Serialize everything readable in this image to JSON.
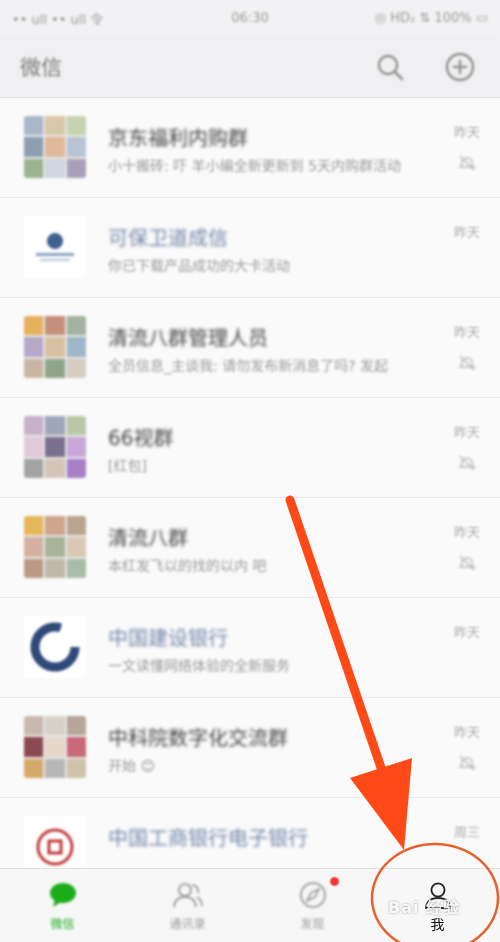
{
  "status_bar": {
    "left": "•• ull •• ull 令",
    "time": "06:30",
    "right": "◎ HD₂ ⇅ 100% ▭"
  },
  "header": {
    "title": "微信"
  },
  "chats": [
    {
      "title": "京东福利内购群",
      "subtitle": "小十搬砖: 吓 羊小编全新更新到 5天内购群活动",
      "time": "昨天",
      "muted": true,
      "title_style": "normal"
    },
    {
      "title": "可保卫道成信",
      "subtitle": "你已下载产品成功的大卡活动",
      "time": "昨天",
      "muted": false,
      "title_style": "blue"
    },
    {
      "title": "清流八群管理人员",
      "subtitle": "全员信息_主谈我: 请勿发布新消息了吗? 发起",
      "time": "昨天",
      "muted": true,
      "title_style": "normal"
    },
    {
      "title": "66视群",
      "subtitle": "[红包]",
      "time": "昨天",
      "muted": true,
      "title_style": "normal"
    },
    {
      "title": "清流八群",
      "subtitle": "本红发飞以的找的以内 吧",
      "time": "昨天",
      "muted": true,
      "title_style": "normal"
    },
    {
      "title": "中国建设银行",
      "subtitle": "一文读懂网络体验的全新服务",
      "time": "昨天",
      "muted": false,
      "title_style": "blue"
    },
    {
      "title": "中科院数字化交流群",
      "subtitle": "开始 😊",
      "time": "昨天",
      "muted": true,
      "title_style": "normal"
    },
    {
      "title": "中国工商银行电子银行",
      "subtitle": "",
      "time": "周三",
      "muted": false,
      "title_style": "blue"
    }
  ],
  "tabs": [
    {
      "label": "微信",
      "icon": "chat-bubble-icon",
      "active": true
    },
    {
      "label": "通讯录",
      "icon": "contacts-icon",
      "active": false
    },
    {
      "label": "发现",
      "icon": "compass-icon",
      "active": false,
      "badge": true
    },
    {
      "label": "我",
      "icon": "person-icon",
      "active": false
    }
  ],
  "watermark": {
    "text": "Bai 经验"
  },
  "colors": {
    "accent_green": "#1aad19",
    "arrow": "#ff4a17",
    "badge_red": "#f43530"
  }
}
